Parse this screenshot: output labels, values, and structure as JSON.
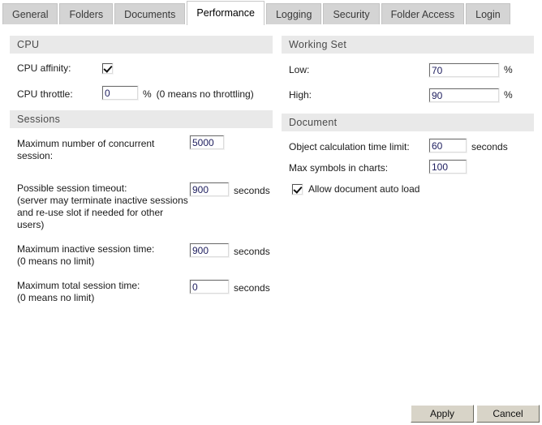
{
  "tabs": [
    {
      "label": "General",
      "active": false
    },
    {
      "label": "Folders",
      "active": false
    },
    {
      "label": "Documents",
      "active": false
    },
    {
      "label": "Performance",
      "active": true
    },
    {
      "label": "Logging",
      "active": false
    },
    {
      "label": "Security",
      "active": false
    },
    {
      "label": "Folder Access",
      "active": false
    },
    {
      "label": "Login",
      "active": false
    }
  ],
  "cpu": {
    "header": "CPU",
    "affinity_label": "CPU affinity:",
    "affinity_checked": true,
    "throttle_label": "CPU throttle:",
    "throttle_value": "0",
    "throttle_unit": "%",
    "throttle_hint": "(0 means no throttling)"
  },
  "sessions": {
    "header": "Sessions",
    "max_concurrent_label": "Maximum number of concurrent session:",
    "max_concurrent_value": "5000",
    "possible_timeout_line1": "Possible session timeout:",
    "possible_timeout_line2": "(server may terminate inactive sessions",
    "possible_timeout_line3": "and re-use slot if needed for other users)",
    "possible_timeout_value": "900",
    "possible_timeout_unit": "seconds",
    "max_inactive_line1": "Maximum inactive session time:",
    "max_inactive_line2": "(0 means no limit)",
    "max_inactive_value": "900",
    "max_inactive_unit": "seconds",
    "max_total_line1": "Maximum total session time:",
    "max_total_line2": "(0 means no limit)",
    "max_total_value": "0",
    "max_total_unit": "seconds"
  },
  "working_set": {
    "header": "Working Set",
    "low_label": "Low:",
    "low_value": "70",
    "low_unit": "%",
    "high_label": "High:",
    "high_value": "90",
    "high_unit": "%"
  },
  "document": {
    "header": "Document",
    "calc_limit_label": "Object calculation time limit:",
    "calc_limit_value": "60",
    "calc_limit_unit": "seconds",
    "max_symbols_label": "Max symbols in charts:",
    "max_symbols_value": "100",
    "auto_load_label": "Allow document auto load",
    "auto_load_checked": true
  },
  "footer": {
    "apply_label": "Apply",
    "cancel_label": "Cancel"
  },
  "colors": {
    "tab_inactive_bg": "#d4d4d4",
    "tab_active_bg": "#ffffff",
    "section_header_bg": "#e9e9e9",
    "input_text": "#202060",
    "button_bg": "#d8d4c8"
  }
}
